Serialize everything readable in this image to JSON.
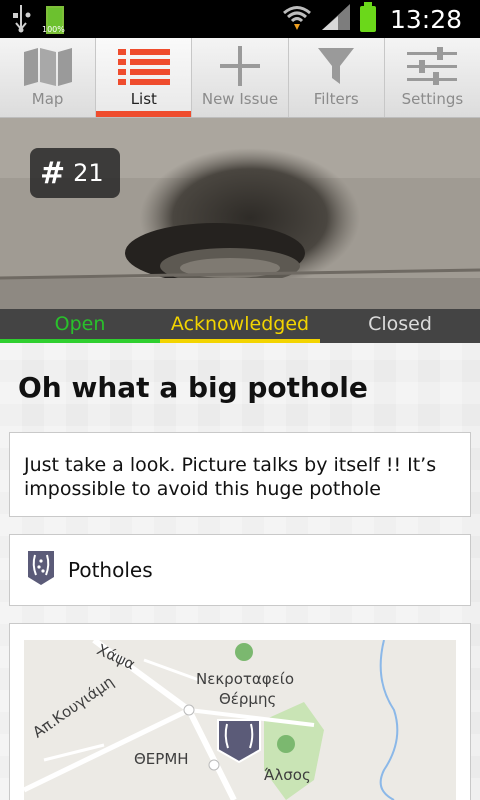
{
  "status_bar": {
    "time": "13:28",
    "battery_small_label": "100%"
  },
  "tabs": [
    {
      "label": "Map",
      "icon": "map-icon",
      "active": false
    },
    {
      "label": "List",
      "icon": "list-icon",
      "active": true
    },
    {
      "label": "New Issue",
      "icon": "plus-icon",
      "active": false
    },
    {
      "label": "Filters",
      "icon": "filter-icon",
      "active": false
    },
    {
      "label": "Settings",
      "icon": "sliders-icon",
      "active": false
    }
  ],
  "issue": {
    "hash": "#",
    "number": "21",
    "title": "Oh what a big pothole",
    "description": "Just take a look. Picture talks by itself !! It’s impossible to avoid this huge pothole",
    "category": "Potholes",
    "category_icon": "pothole-category-icon"
  },
  "status_steps": {
    "open": "Open",
    "acknowledged": "Acknowledged",
    "closed": "Closed"
  },
  "colors": {
    "accent": "#ef4c2d",
    "open": "#2fcf2f",
    "acknowledged": "#f3d400",
    "closed": "#dcdcdc",
    "category_marker": "#5b5b78"
  },
  "map": {
    "labels": {
      "road1": "Χάψα",
      "road2": "Απ.Κουγιάμη",
      "cemetery": "Νεκροταφείο",
      "cemetery2": "Θέρμης",
      "district": "ΘΕΡΜΗ",
      "grove": "Άλσος"
    }
  }
}
